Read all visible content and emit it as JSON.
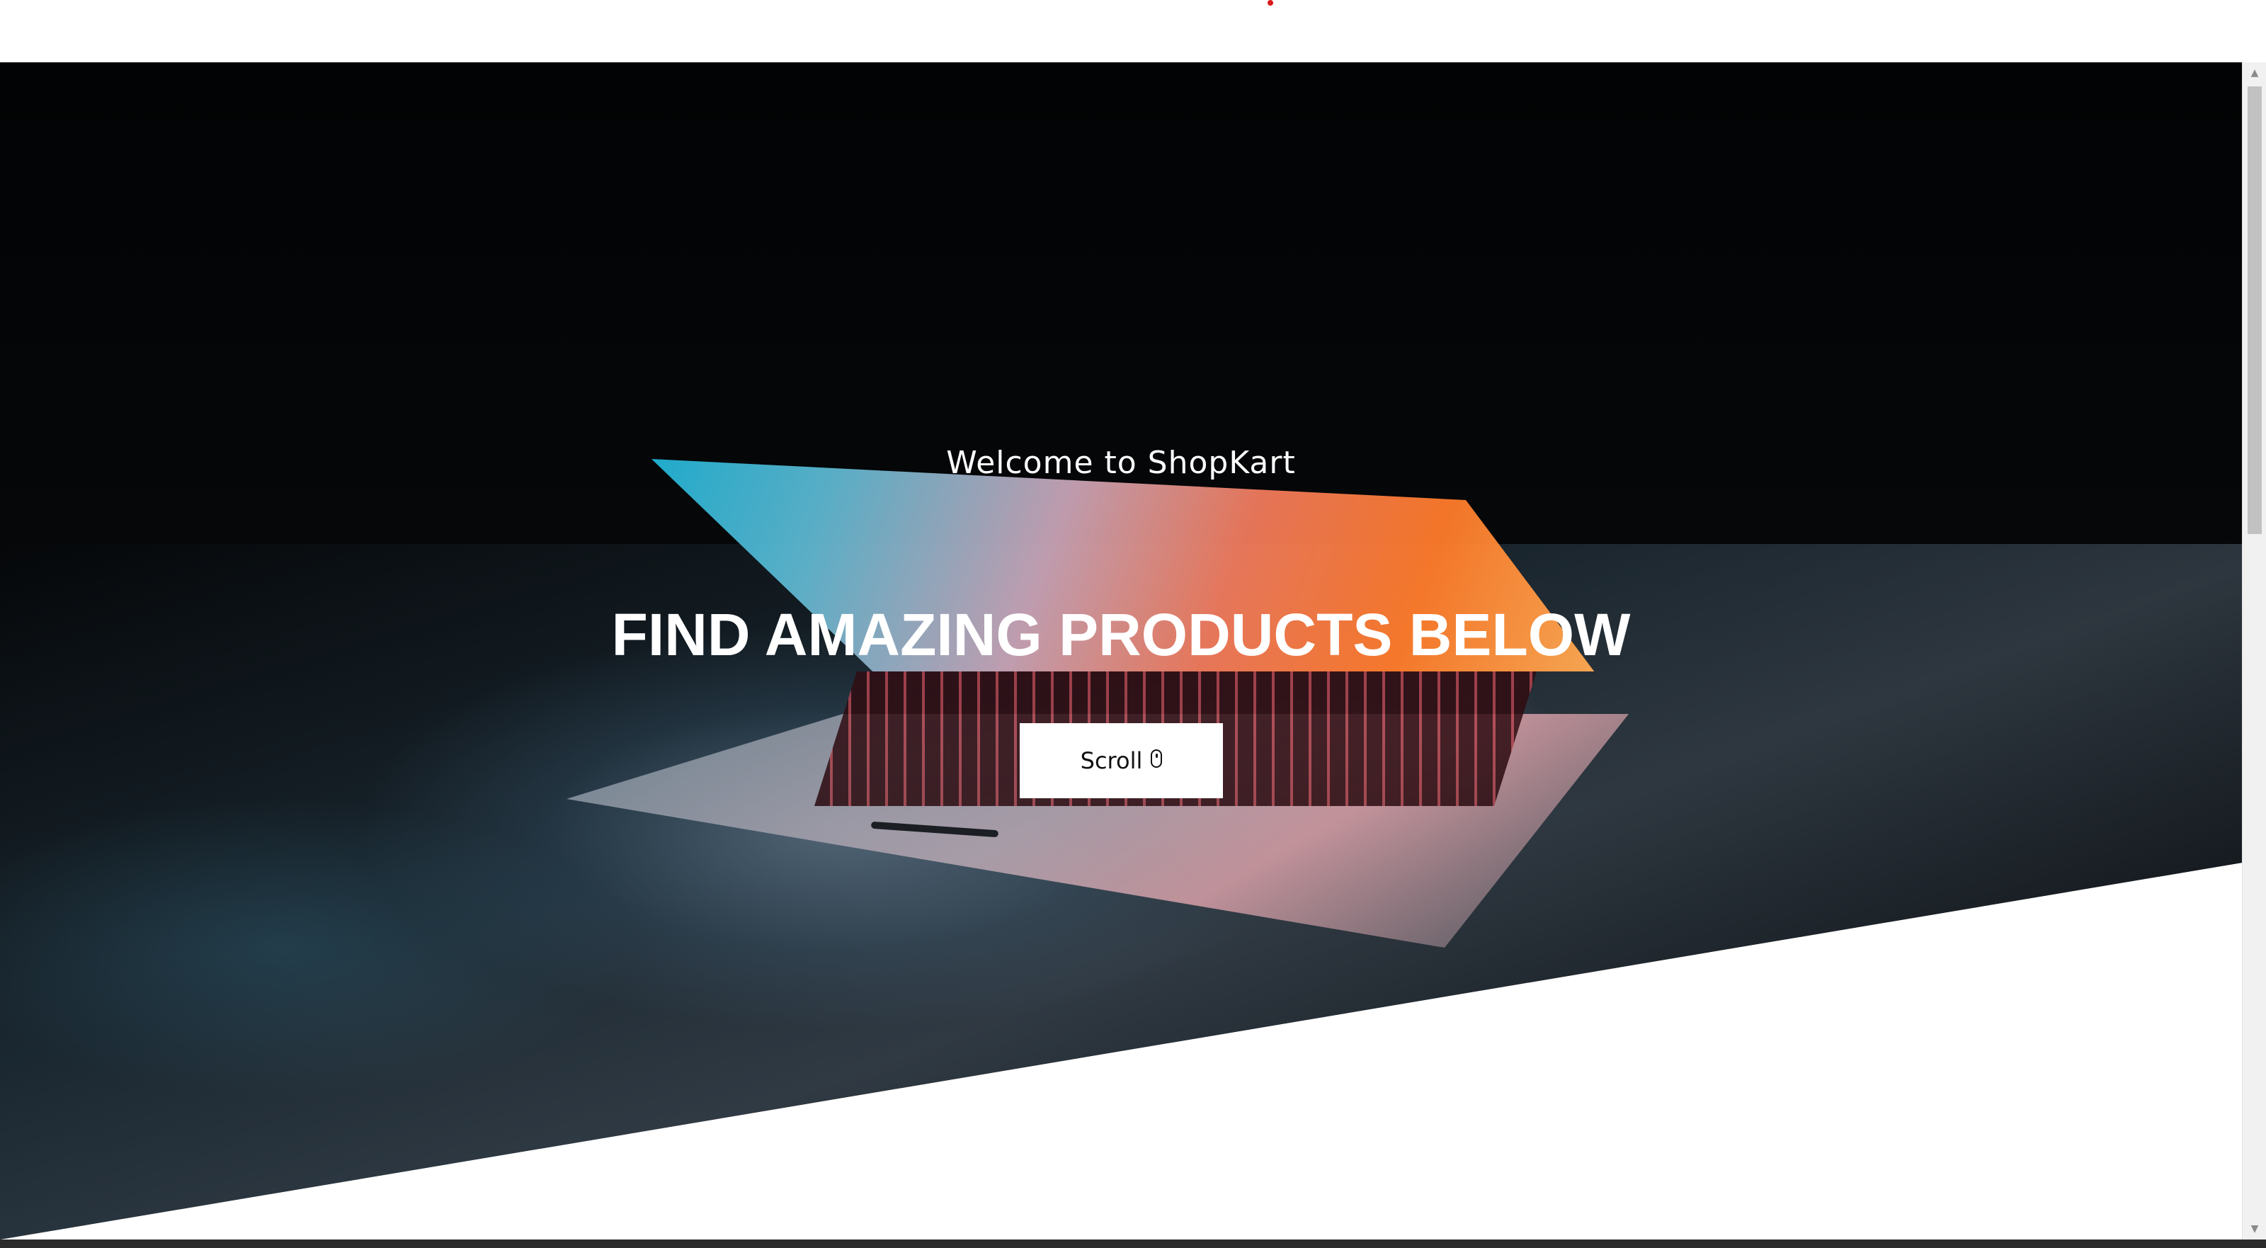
{
  "hero": {
    "welcome_text": "Welcome to ShopKart",
    "headline": "FIND AMAZING PRODUCTS BELOW",
    "scroll_button_label": "Scroll",
    "scroll_button_icon": "mouse-icon"
  },
  "theme": {
    "hero_background": "#000000",
    "button_background": "#ffffff",
    "text_color": "#ffffff",
    "loader_accent": "#d81b1b"
  },
  "scrollbar": {
    "up_icon": "arrow-up-icon",
    "down_icon": "arrow-down-icon"
  }
}
